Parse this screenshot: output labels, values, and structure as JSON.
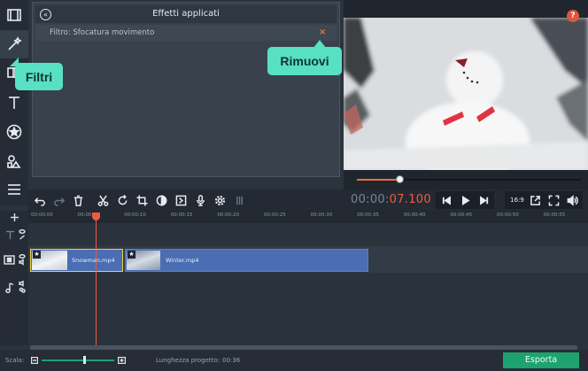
{
  "effects_panel": {
    "title": "Effetti applicati",
    "filter_label": "Filtro: Sfocatura movimento",
    "remove_symbol": "×"
  },
  "callouts": {
    "filters": "Filtri",
    "remove": "Rimuovi"
  },
  "preview": {
    "help_symbol": "?",
    "progress_fraction": 0.19
  },
  "timecode": {
    "dim_part": "00:00:",
    "red_part": "07.100"
  },
  "aspect_ratio": "16:9",
  "ruler_ticks": [
    "00:00:00",
    "00:00:05",
    "00:00:10",
    "00:00:15",
    "00:00:20",
    "00:00:25",
    "00:00:30",
    "00:00:35",
    "00:00:40",
    "00:00:45",
    "00:00:50",
    "00:00:55"
  ],
  "clips": [
    {
      "name": "Snowman.mp4",
      "star": "★"
    },
    {
      "name": "Winter.mp4",
      "star": "★"
    }
  ],
  "status": {
    "scale_label": "Scala:",
    "length_label": "Lunghezza progetto:",
    "length_value": "00:36",
    "export_label": "Esporta"
  },
  "colors": {
    "accent_red": "#ef5b3f",
    "callout": "#58e0c5",
    "export_green": "#1ea26e",
    "clip_blue": "#4a6db3"
  }
}
